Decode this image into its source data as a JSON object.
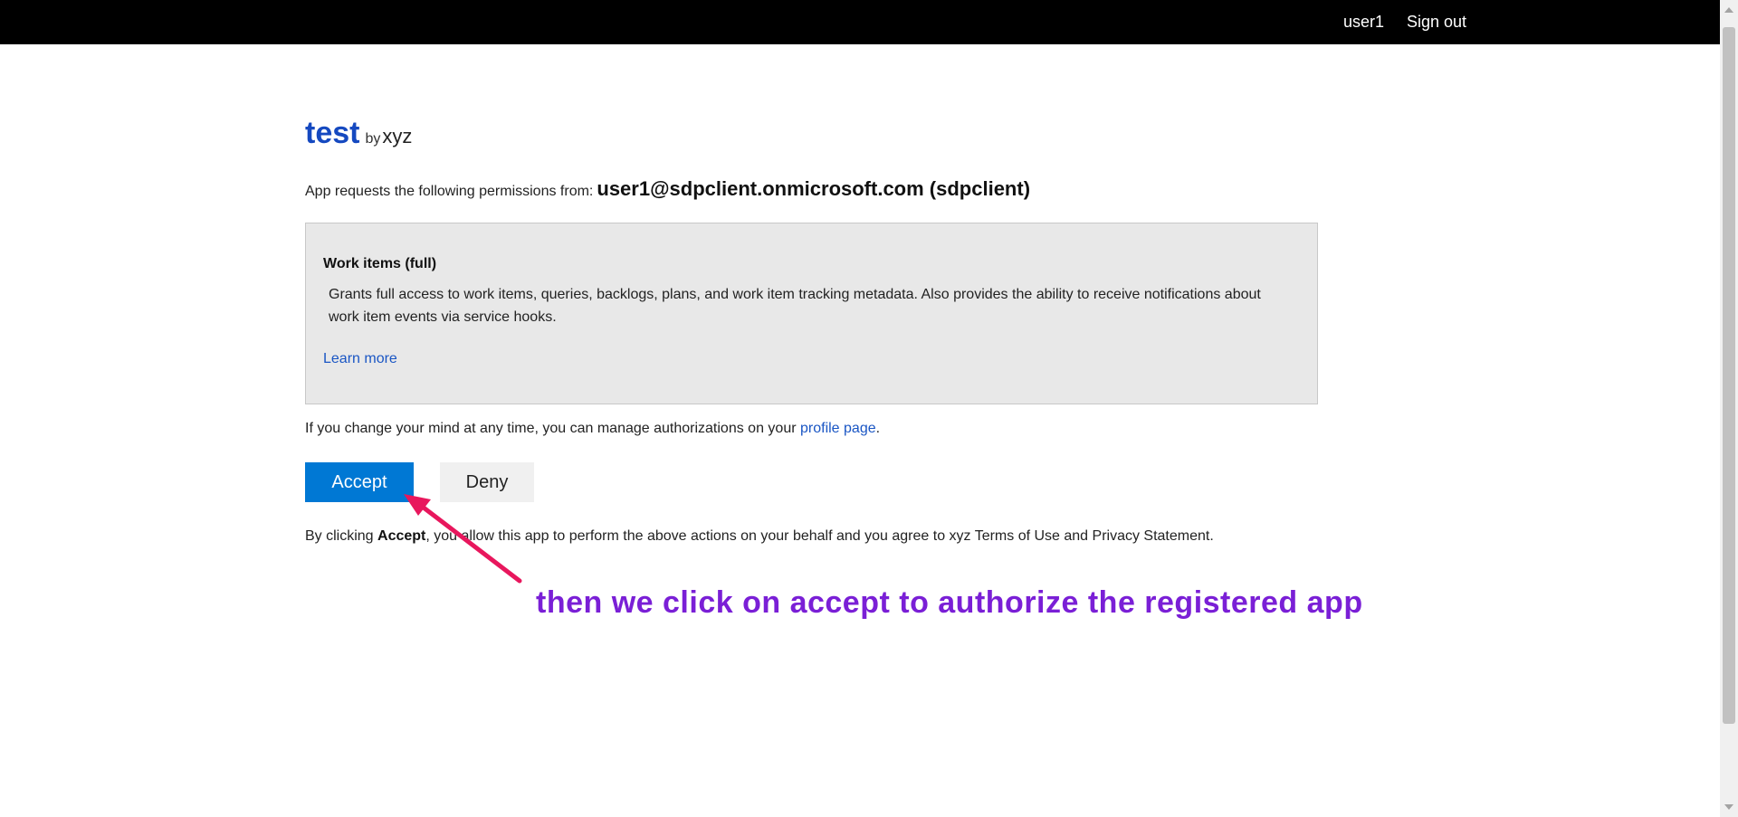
{
  "header": {
    "user": "user1",
    "sign_out": "Sign out"
  },
  "app": {
    "name": "test",
    "by": "by",
    "publisher": "xyz"
  },
  "request": {
    "text": "App requests the following permissions from:",
    "account": "user1@sdpclient.onmicrosoft.com (sdpclient)"
  },
  "permission": {
    "title": "Work items (full)",
    "description": "Grants full access to work items, queries, backlogs, plans, and work item tracking metadata. Also provides the ability to receive notifications about work item events via service hooks.",
    "learn_more": "Learn more"
  },
  "manage": {
    "prefix": "If you change your mind at any time, you can manage authorizations on your",
    "link": "profile page",
    "suffix": "."
  },
  "buttons": {
    "accept": "Accept",
    "deny": "Deny"
  },
  "terms": {
    "prefix": "By clicking",
    "bold": "Accept",
    "suffix": ", you allow this app to perform the above actions on your behalf and you agree to xyz Terms of Use and Privacy Statement."
  },
  "annotation": {
    "text": "then we click on accept to authorize the registered app"
  },
  "colors": {
    "accent": "#0078d4",
    "app_name": "#1549c0",
    "link": "#1a56c4",
    "annotation": "#7a1fd6",
    "arrow": "#e8175d"
  }
}
